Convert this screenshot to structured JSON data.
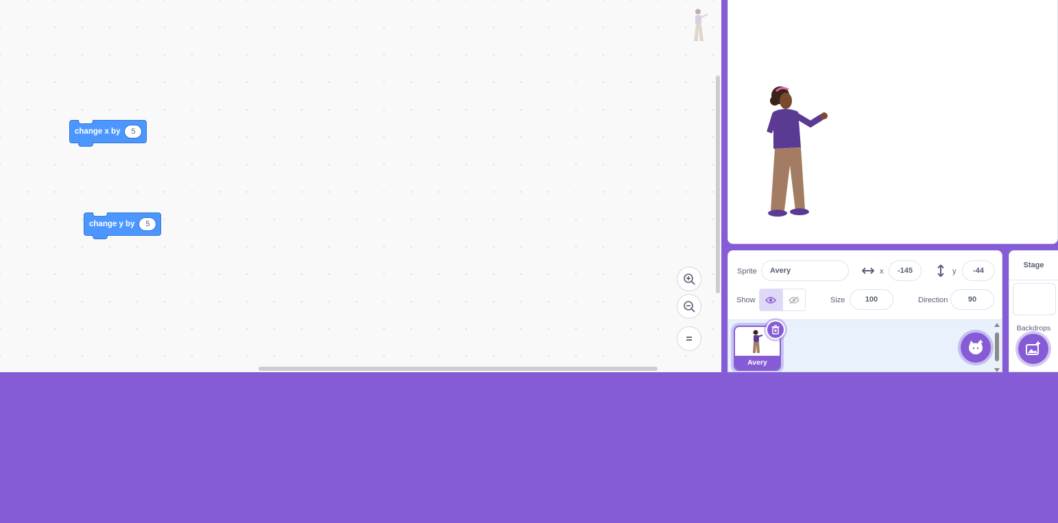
{
  "workspace": {
    "blocks": [
      {
        "label": "change x by",
        "value": "5"
      },
      {
        "label": "change y by",
        "value": "5"
      }
    ],
    "zoom_controls": [
      "zoom-in-icon",
      "zoom-out-icon",
      "zoom-reset-icon"
    ]
  },
  "sprite_info": {
    "sprite_label": "Sprite",
    "sprite_name": "Avery",
    "x_label": "x",
    "x_value": "-145",
    "y_label": "y",
    "y_value": "-44",
    "show_label": "Show",
    "size_label": "Size",
    "size_value": "100",
    "direction_label": "Direction",
    "direction_value": "90"
  },
  "sprites": [
    {
      "name": "Avery",
      "selected": true
    }
  ],
  "stage_pane": {
    "title": "Stage",
    "backdrops_label": "Backdrops"
  },
  "colors": {
    "accent": "#855cd6",
    "motion_block": "#4c97ff",
    "pane_bg": "#e9f1fc"
  }
}
